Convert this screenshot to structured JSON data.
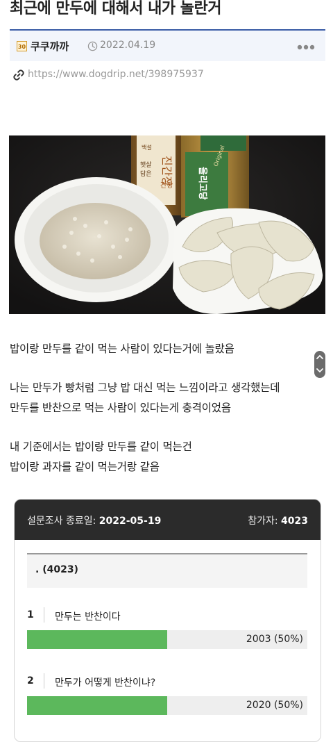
{
  "post": {
    "title": "최근에 만두에 대해서 내가 놀란거",
    "author_icon_text": "30",
    "author": "쿠쿠까까",
    "date": "2022.04.19",
    "link": "https://www.dogdrip.net/398975937"
  },
  "photo": {
    "bottle_left_labels": [
      "백설",
      "햇살",
      "담은",
      "진간장",
      "간장"
    ],
    "bottle_right_labels": [
      "Original",
      "올리고당"
    ]
  },
  "body": {
    "lines": [
      "밥이랑 만두를 같이 먹는 사람이 있다는거에 놀랐음",
      "나는 만두가 빵처럼 그냥 밥 대신 먹는 느낌이라고 생각했는데",
      "만두를 반찬으로 먹는 사람이 있다는게 충격이었음",
      "내 기준에서는 밥이랑 만두를 같이 먹는건",
      "밥이랑 과자를 같이 먹는거랑 같음"
    ]
  },
  "poll": {
    "end_label": "설문조사 종료일: ",
    "end_date": "2022-05-19",
    "count_label": "참가자: ",
    "count": "4023",
    "question": ". (4023)",
    "options": [
      {
        "num": "1",
        "label": "만두는 반찬이다",
        "result": "2003 (50%)",
        "percent": 50
      },
      {
        "num": "2",
        "label": "만두가 어떻게 반찬이냐?",
        "result": "2020 (50%)",
        "percent": 50
      }
    ],
    "bar_color": "#5cb85c"
  }
}
